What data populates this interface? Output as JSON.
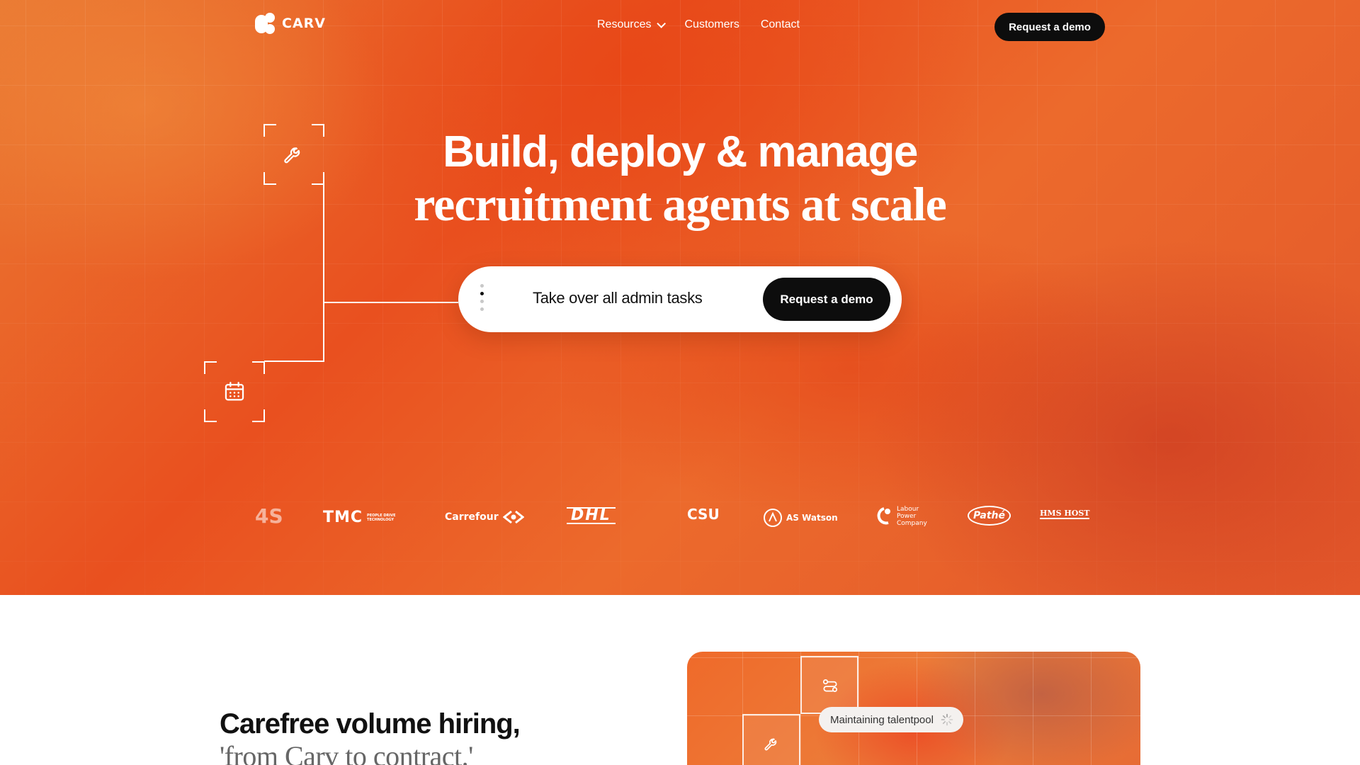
{
  "nav": {
    "brand": "CARV",
    "links": [
      {
        "label": "Resources",
        "has_dropdown": true
      },
      {
        "label": "Customers"
      },
      {
        "label": "Contact"
      }
    ],
    "cta_label": "Request a demo"
  },
  "hero": {
    "title_line1": "Build, deploy & manage",
    "title_line2": "recruitment agents at scale",
    "pill_text": "Take over all admin tasks",
    "pill_cta_label": "Request a demo",
    "flow_icons": [
      "wrench-icon",
      "calendar-icon"
    ]
  },
  "customer_logos": [
    {
      "name": "4S"
    },
    {
      "name": "TMC",
      "tagline": "PEOPLE DRIVE TECHNOLOGY"
    },
    {
      "name": "Carrefour"
    },
    {
      "name": "DHL"
    },
    {
      "name": "CSU"
    },
    {
      "name": "AS Watson"
    },
    {
      "name": "Labour Power Company"
    },
    {
      "name": "Pathé"
    },
    {
      "name": "HMS HOST"
    }
  ],
  "section": {
    "title": "Carefree volume hiring,",
    "subtitle": "'from Carv to contract.'",
    "status_chip": "Maintaining talentpool"
  },
  "colors": {
    "hero_orange": "#e9501f",
    "accent_dark": "#0d0d0d",
    "white": "#ffffff"
  }
}
